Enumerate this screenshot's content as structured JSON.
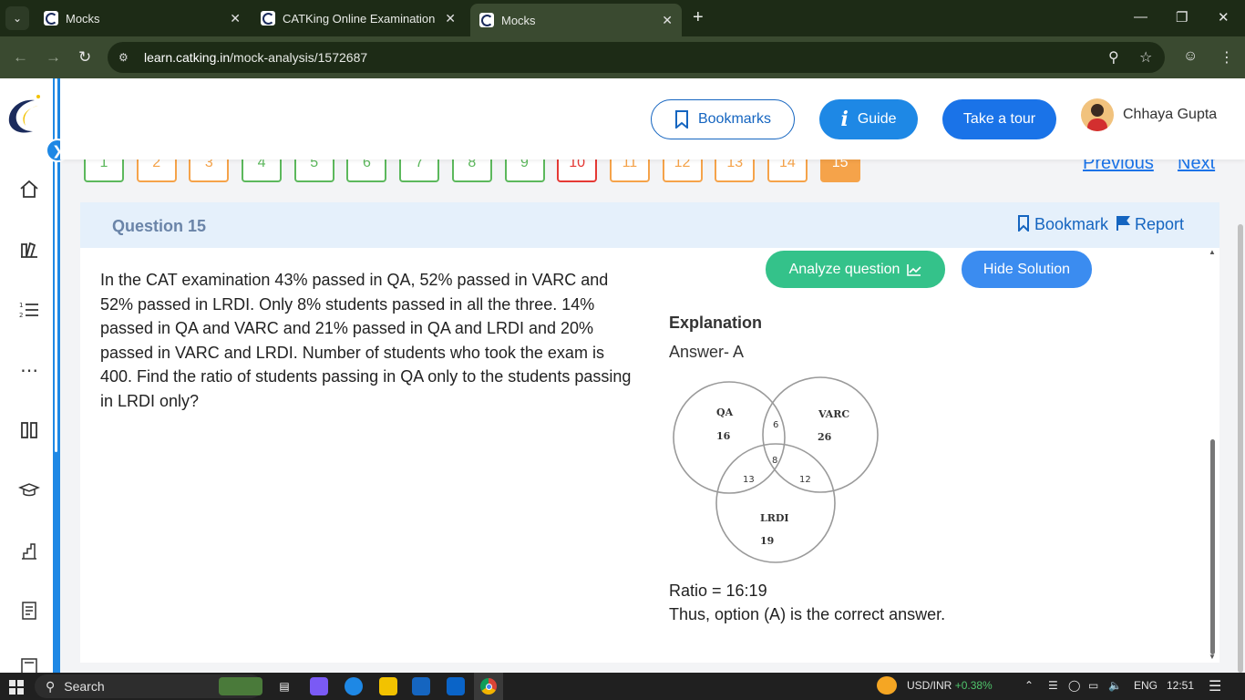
{
  "browser": {
    "tabs": [
      {
        "title": "Mocks",
        "active": false
      },
      {
        "title": "CATKing Online Examination Pl",
        "active": false
      },
      {
        "title": "Mocks",
        "active": true
      }
    ],
    "url_domain": "learn.catking.in",
    "url_path": "/mock-analysis/1572687"
  },
  "header": {
    "bookmarks_label": "Bookmarks",
    "guide_label": "Guide",
    "tour_label": "Take a tour",
    "user_name": "Chhaya Gupta"
  },
  "question_nav": {
    "numbers": [
      {
        "n": "1",
        "status": "green"
      },
      {
        "n": "2",
        "status": "orange"
      },
      {
        "n": "3",
        "status": "orange"
      },
      {
        "n": "4",
        "status": "green"
      },
      {
        "n": "5",
        "status": "green"
      },
      {
        "n": "6",
        "status": "green"
      },
      {
        "n": "7",
        "status": "green"
      },
      {
        "n": "8",
        "status": "green"
      },
      {
        "n": "9",
        "status": "green"
      },
      {
        "n": "10",
        "status": "red"
      },
      {
        "n": "11",
        "status": "orange"
      },
      {
        "n": "12",
        "status": "orange"
      },
      {
        "n": "13",
        "status": "orange"
      },
      {
        "n": "14",
        "status": "orange"
      },
      {
        "n": "15",
        "status": "current"
      }
    ],
    "previous_label": "Previous",
    "next_label": "Next"
  },
  "question": {
    "title": "Question 15",
    "bookmark_label": "Bookmark",
    "report_label": "Report",
    "text": "In the CAT examination 43% passed in QA, 52% passed in VARC and 52% passed in LRDI. Only 8% students passed in all the three. 14% passed in QA and VARC and 21% passed in QA and LRDI and 20% passed in VARC and LRDI. Number of students who took the exam is 400. Find the ratio of students passing in QA only to the students passing in LRDI only?"
  },
  "solution": {
    "analyze_label": "Analyze question",
    "hide_label": "Hide Solution",
    "explanation_title": "Explanation",
    "answer": "Answer- A",
    "venn": {
      "qa_label": "QA",
      "qa_only": "16",
      "varc_label": "VARC",
      "varc_only": "26",
      "lrdi_label": "LRDI",
      "lrdi_only": "19",
      "qa_varc": "6",
      "qa_lrdi": "13",
      "varc_lrdi": "12",
      "all": "8"
    },
    "ratio": "Ratio = 16:19",
    "conclusion": "Thus, option (A) is the correct answer."
  },
  "taskbar": {
    "search_label": "Search",
    "ticker": "USD/INR",
    "ticker_change": "+0.38%",
    "lang": "ENG",
    "time": "12:51"
  }
}
